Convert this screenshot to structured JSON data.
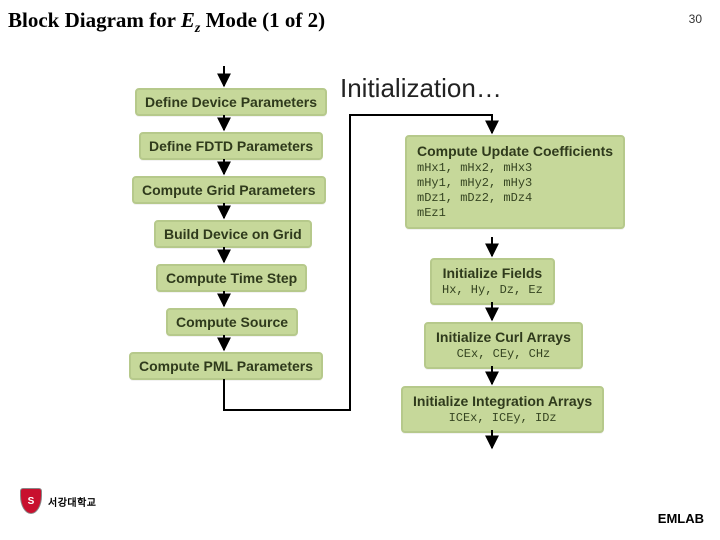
{
  "header": {
    "title_prefix": "Block Diagram for ",
    "title_var": "E",
    "title_sub": "z",
    "title_suffix": " Mode (1 of 2)",
    "slide_number": "30"
  },
  "section": {
    "title": "Initialization…"
  },
  "left": {
    "b1": "Define Device Parameters",
    "b2": "Define FDTD Parameters",
    "b3": "Compute Grid Parameters",
    "b4": "Build Device on Grid",
    "b5": "Compute Time Step",
    "b6": "Compute Source",
    "b7": "Compute PML Parameters"
  },
  "right": {
    "b1_title": "Compute Update Coefficients",
    "b1_line1": "mHx1, mHx2, mHx3",
    "b1_line2": "mHy1, mHy2, mHy3",
    "b1_line3": "mDz1, mDz2, mDz4",
    "b1_line4": "mEz1",
    "b2_title": "Initialize Fields",
    "b2_line1": "Hx, Hy, Dz, Ez",
    "b3_title": "Initialize Curl Arrays",
    "b3_line1": "CEx, CEy, CHz",
    "b4_title": "Initialize Integration Arrays",
    "b4_line1": "ICEx, ICEy, IDz"
  },
  "footer": {
    "university": "서강대학교",
    "lab": "EMLAB"
  }
}
